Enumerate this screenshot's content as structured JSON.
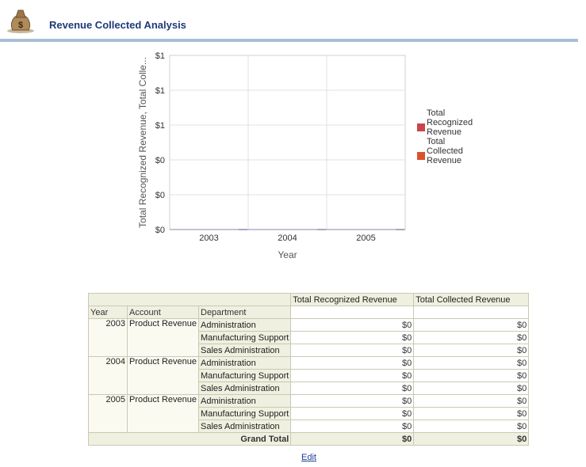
{
  "page": {
    "title": "Revenue Collected Analysis"
  },
  "icons": {
    "header": "money-bag-icon"
  },
  "chart_data": {
    "type": "bar",
    "categories": [
      "2003",
      "2004",
      "2005"
    ],
    "series": [
      {
        "name": "Total Recognized Revenue",
        "values": [
          0,
          0,
          0
        ],
        "color": "#c8464a"
      },
      {
        "name": "Total Collected Revenue",
        "values": [
          0,
          0,
          0
        ],
        "color": "#d9532b"
      }
    ],
    "xlabel": "Year",
    "ylabel": "Total Recognized Revenue, Total Colle...",
    "y_tick_labels": [
      "$0",
      "$0",
      "$0",
      "$1",
      "$1",
      "$1"
    ],
    "legend": [
      "Total Recognized Revenue",
      "Total Collected Revenue"
    ],
    "legend_position": "right",
    "grid": true
  },
  "table": {
    "measure_headers": [
      "Total Recognized Revenue",
      "Total Collected Revenue"
    ],
    "row_headers": [
      "Year",
      "Account",
      "Department"
    ],
    "groups": [
      {
        "year": "2003",
        "account": "Product Revenue",
        "rows": [
          {
            "department": "Administration",
            "recognized": "$0",
            "collected": "$0"
          },
          {
            "department": "Manufacturing Support",
            "recognized": "$0",
            "collected": "$0"
          },
          {
            "department": "Sales Administration",
            "recognized": "$0",
            "collected": "$0"
          }
        ]
      },
      {
        "year": "2004",
        "account": "Product Revenue",
        "rows": [
          {
            "department": "Administration",
            "recognized": "$0",
            "collected": "$0"
          },
          {
            "department": "Manufacturing Support",
            "recognized": "$0",
            "collected": "$0"
          },
          {
            "department": "Sales Administration",
            "recognized": "$0",
            "collected": "$0"
          }
        ]
      },
      {
        "year": "2005",
        "account": "Product Revenue",
        "rows": [
          {
            "department": "Administration",
            "recognized": "$0",
            "collected": "$0"
          },
          {
            "department": "Manufacturing Support",
            "recognized": "$0",
            "collected": "$0"
          },
          {
            "department": "Sales Administration",
            "recognized": "$0",
            "collected": "$0"
          }
        ]
      }
    ],
    "grand_total": {
      "label": "Grand Total",
      "recognized": "$0",
      "collected": "$0"
    }
  },
  "links": {
    "edit": "Edit"
  }
}
